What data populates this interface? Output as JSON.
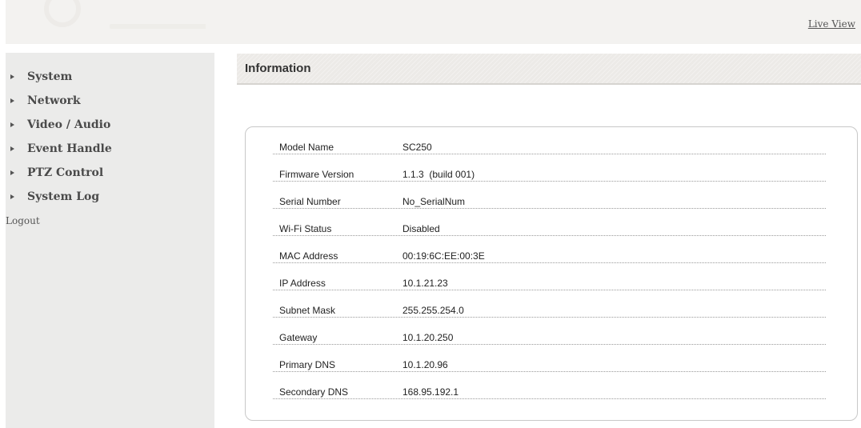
{
  "header": {
    "live_view_label": "Live View"
  },
  "sidebar": {
    "items": [
      {
        "label": "System"
      },
      {
        "label": "Network"
      },
      {
        "label": "Video / Audio"
      },
      {
        "label": "Event Handle"
      },
      {
        "label": "PTZ Control"
      },
      {
        "label": "System Log"
      }
    ],
    "logout_label": "Logout"
  },
  "main": {
    "section_title": "Information",
    "info": [
      {
        "label": "Model Name",
        "value": "SC250"
      },
      {
        "label": "Firmware Version",
        "value": "1.1.3  (build 001)"
      },
      {
        "label": "Serial Number",
        "value": "No_SerialNum"
      },
      {
        "label": "Wi-Fi Status",
        "value": "Disabled"
      },
      {
        "label": "MAC Address",
        "value": "00:19:6C:EE:00:3E"
      },
      {
        "label": "IP Address",
        "value": "10.1.21.23"
      },
      {
        "label": "Subnet Mask",
        "value": "255.255.254.0"
      },
      {
        "label": "Gateway",
        "value": "10.1.20.250"
      },
      {
        "label": "Primary DNS",
        "value": "10.1.20.96"
      },
      {
        "label": "Secondary DNS",
        "value": "168.95.192.1"
      }
    ]
  },
  "colors": {
    "header_bg": "#f3f2f0",
    "sidebar_bg": "#ebebea",
    "section_header_bg": "#eceae7",
    "text": "#333333"
  }
}
